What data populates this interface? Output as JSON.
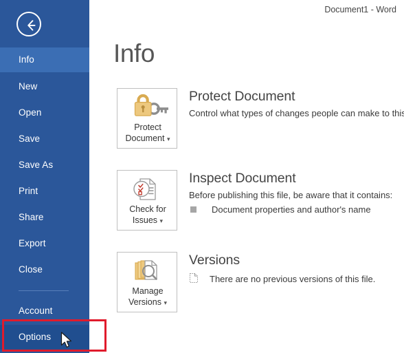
{
  "window": {
    "title": "Document1 - Word"
  },
  "sidebar": {
    "back_icon": "back-arrow-icon",
    "items": [
      {
        "label": "Info",
        "state": "selected"
      },
      {
        "label": "New",
        "state": "normal"
      },
      {
        "label": "Open",
        "state": "normal"
      },
      {
        "label": "Save",
        "state": "normal"
      },
      {
        "label": "Save As",
        "state": "normal"
      },
      {
        "label": "Print",
        "state": "normal"
      },
      {
        "label": "Share",
        "state": "normal"
      },
      {
        "label": "Export",
        "state": "normal"
      },
      {
        "label": "Close",
        "state": "normal"
      },
      {
        "label": "Account",
        "state": "normal"
      },
      {
        "label": "Options",
        "state": "hovered"
      }
    ]
  },
  "main": {
    "page_title": "Info",
    "sections": [
      {
        "button_label_line1": "Protect",
        "button_label_line2": "Document",
        "button_caret": "▾",
        "icon": "lock-and-key-icon",
        "heading": "Protect Document",
        "description": "Control what types of changes people can make to this doc",
        "bullets": []
      },
      {
        "button_label_line1": "Check for",
        "button_label_line2": "Issues",
        "button_caret": "▾",
        "icon": "document-checklist-icon",
        "heading": "Inspect Document",
        "description": "Before publishing this file, be aware that it contains:",
        "bullets": [
          {
            "marker": "square",
            "text": "Document properties and author's name"
          }
        ]
      },
      {
        "button_label_line1": "Manage",
        "button_label_line2": "Versions",
        "button_caret": "▾",
        "icon": "document-stack-magnifier-icon",
        "heading": "Versions",
        "description": "",
        "bullets": [
          {
            "marker": "document",
            "text": "There are no previous versions of this file."
          }
        ]
      }
    ]
  },
  "annotation": {
    "highlight_target": "Options",
    "highlight_color": "#e01b2c"
  },
  "colors": {
    "sidebar_bg": "#2b579a",
    "sidebar_selected": "#3b6eb4",
    "sidebar_hovered": "#204e8f",
    "content_bg": "#ffffff",
    "heading_text": "#444444",
    "accent_gold": "#e8c06a"
  }
}
